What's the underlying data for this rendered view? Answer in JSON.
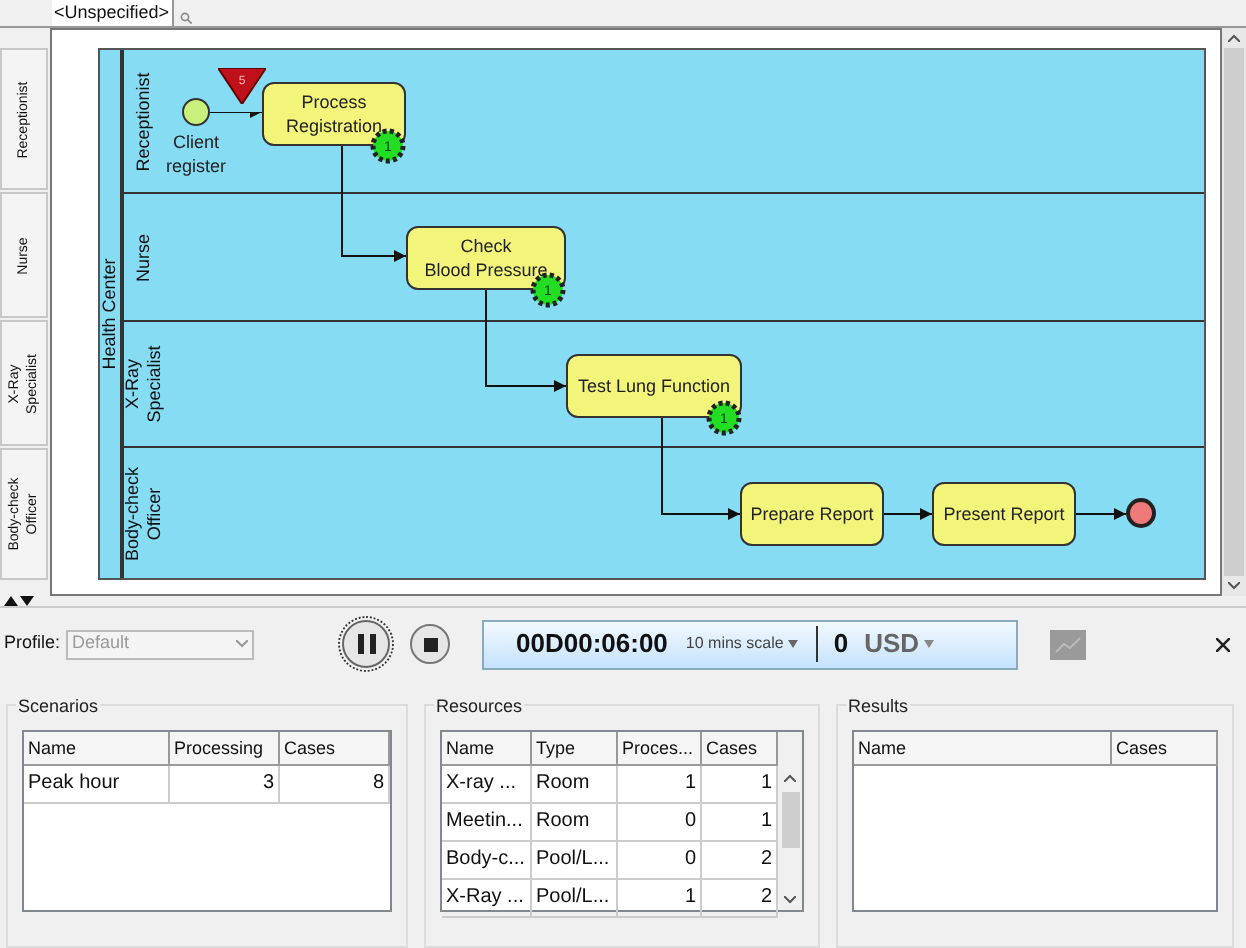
{
  "toolbar": {
    "selector": "<Unspecified>"
  },
  "side_tabs": [
    {
      "label": "Receptionist"
    },
    {
      "label": "Nurse"
    },
    {
      "label": "X-Ray\nSpecialist"
    },
    {
      "label": "Body-check\nOfficer"
    }
  ],
  "diagram": {
    "pool": "Health Center",
    "lanes": [
      {
        "label": "Receptionist"
      },
      {
        "label": "Nurse"
      },
      {
        "label": "X-Ray\nSpecialist"
      },
      {
        "label": "Body-check\nOfficer"
      }
    ],
    "nodes": [
      {
        "kind": "start",
        "label": "Client\nregister",
        "token": "5"
      },
      {
        "kind": "task",
        "label": "Process\nRegistration",
        "badge": "1"
      },
      {
        "kind": "task",
        "label": "Check\nBlood Pressure",
        "badge": "1"
      },
      {
        "kind": "task",
        "label": "Test Lung Function",
        "badge": "1"
      },
      {
        "kind": "task",
        "label": "Prepare Report"
      },
      {
        "kind": "task",
        "label": "Present Report"
      },
      {
        "kind": "end"
      }
    ]
  },
  "simulation": {
    "profile_label": "Profile:",
    "profile_value": "Default",
    "profile_disabled": true,
    "clock": "00D00:06:00",
    "scale": "10 mins scale",
    "cost": "0",
    "currency": "USD"
  },
  "scenarios": {
    "title": "Scenarios",
    "columns": [
      "Name",
      "Processing",
      "Cases"
    ],
    "rows": [
      [
        "Peak hour",
        "3",
        "8"
      ]
    ]
  },
  "resources": {
    "title": "Resources",
    "columns": [
      "Name",
      "Type",
      "Proces...",
      "Cases"
    ],
    "rows": [
      [
        "X-ray ...",
        "Room",
        "1",
        "1"
      ],
      [
        "Meetin...",
        "Room",
        "0",
        "1"
      ],
      [
        "Body-c...",
        "Pool/L...",
        "0",
        "2"
      ],
      [
        "X-Ray ...",
        "Pool/L...",
        "1",
        "2"
      ]
    ]
  },
  "results": {
    "title": "Results",
    "columns": [
      "Name",
      "Cases"
    ]
  }
}
